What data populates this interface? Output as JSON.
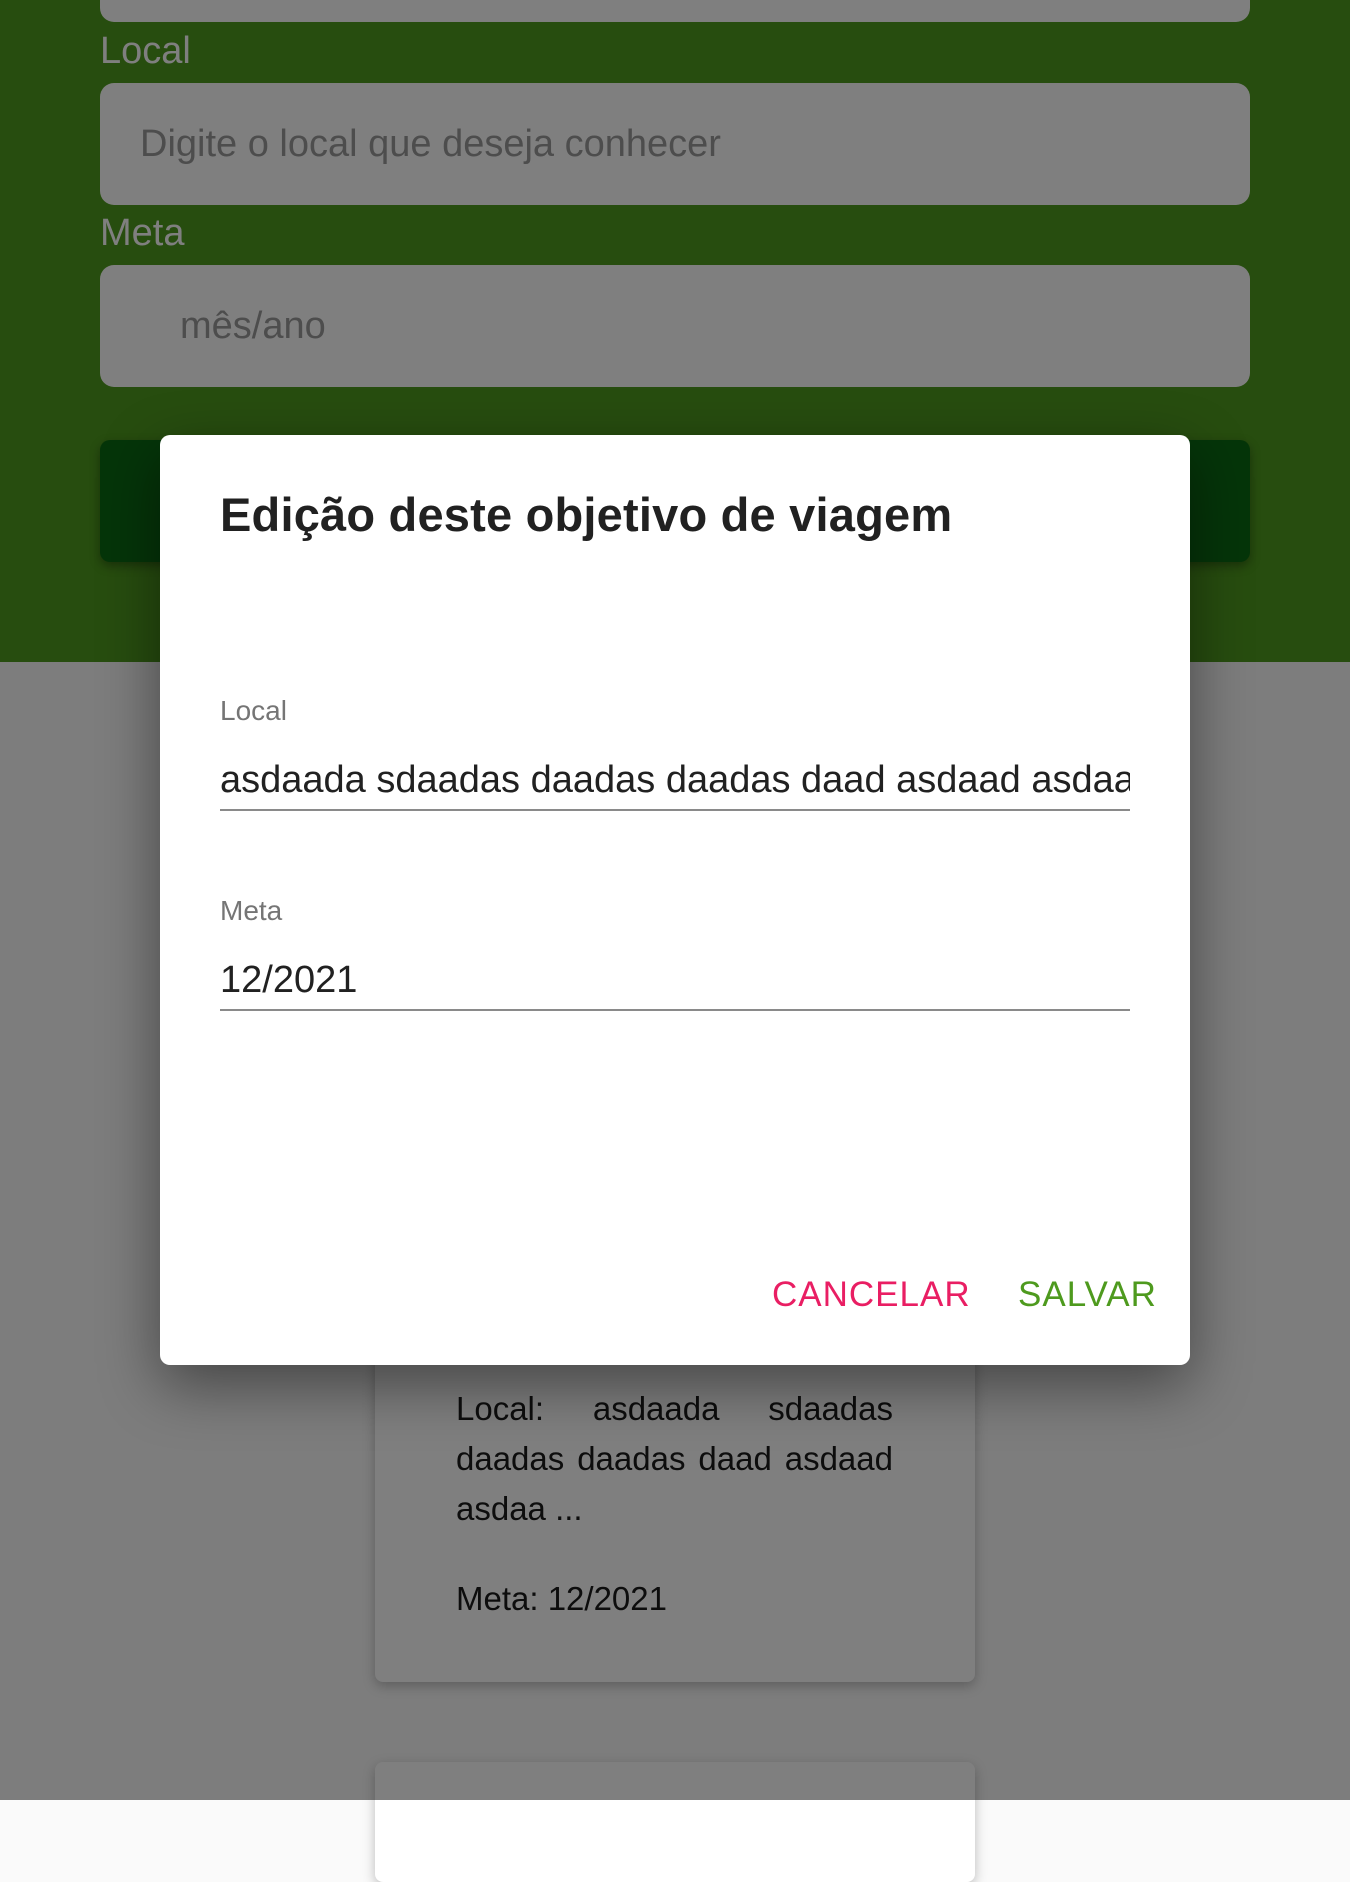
{
  "colors": {
    "hero_green": "#4e9a1e",
    "submit_green": "#0a6b12",
    "cancel_pink": "#e91e63",
    "save_green": "#4e9a1e"
  },
  "form": {
    "local_label": "Local",
    "local_placeholder": "Digite o local que deseja conhecer",
    "meta_label": "Meta",
    "meta_placeholder": "mês/ano"
  },
  "card": {
    "local_text": "Local: asdaada sdaadas daadas daadas daad asdaad asdaa ...",
    "meta_text": "Meta: 12/2021"
  },
  "dialog": {
    "title": "Edição deste objetivo de viagem",
    "local_label": "Local",
    "local_value": "asdaada sdaadas daadas daadas daad asdaad asdaa",
    "meta_label": "Meta",
    "meta_value": "12/2021",
    "cancel_label": "CANCELAR",
    "save_label": "SALVAR"
  }
}
